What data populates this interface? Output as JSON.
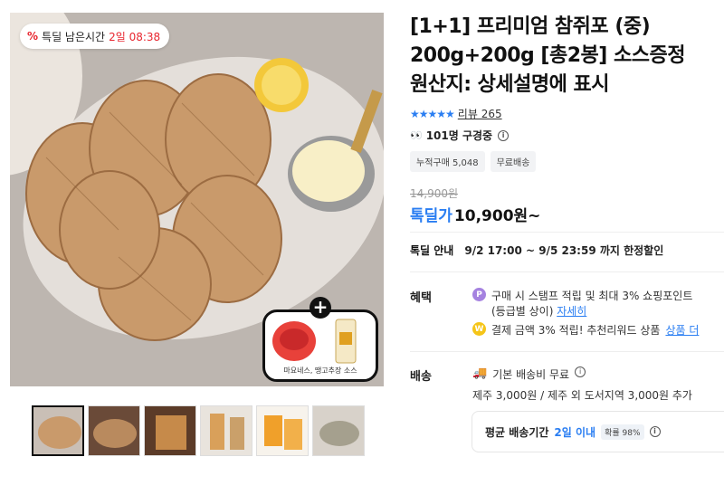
{
  "product_image": {
    "timer_label": "특딜 남은시간",
    "timer_value": "2일 08:38",
    "gift_caption": "마요네스, 땡고추장 소스"
  },
  "thumbnails": [
    "thumb-1",
    "thumb-2",
    "thumb-3",
    "thumb-4",
    "thumb-5",
    "thumb-6"
  ],
  "title_lines": [
    "[1+1] 프리미엄 참쥐포 (중)",
    "200g+200g [총2봉] 소스증정",
    "원산지: 상세설명에 표시"
  ],
  "rating": {
    "stars": "★★★★★",
    "review_label": "리뷰 265"
  },
  "viewers": {
    "text": "101명 구경중"
  },
  "chips": [
    "누적구매 5,048",
    "무료배송"
  ],
  "price": {
    "original": "14,900원",
    "label": "톡딜가",
    "amount": "10,900원~"
  },
  "deal": {
    "label": "톡딜 안내",
    "value": "9/2 17:00 ~ 9/5 23:59 까지 한정할인"
  },
  "benefits": {
    "label": "혜택",
    "line1": "구매 시 스탬프 적립 및 최대 3% 쇼핑포인트",
    "line1_sub": "(등급별 상이)",
    "line1_link": "자세히",
    "line2": "결제 금액 3% 적립! 추천리워드 상품",
    "line2_link": "상품 더"
  },
  "shipping": {
    "label": "배송",
    "base": "기본 배송비 무료",
    "extra": "제주 3,000원 / 제주 외 도서지역 3,000원 추가",
    "avg_label": "평균 배송기간",
    "avg_value": "2일 이내",
    "avg_badge": "확률 98%"
  },
  "colors": {
    "accent_blue": "#2a7ef2",
    "deal_red": "#e8262f"
  }
}
